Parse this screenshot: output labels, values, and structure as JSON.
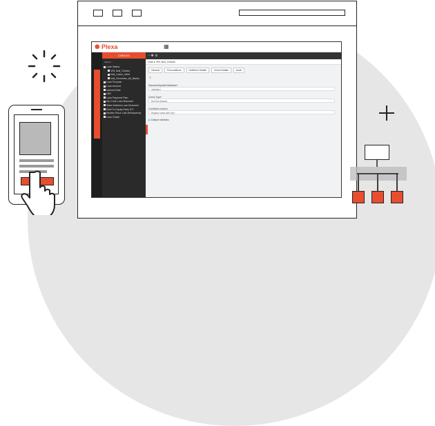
{
  "app": {
    "brand": "Plexa",
    "left_panel_header": "CHECKS",
    "tree_search_label": "Search",
    "tree": [
      {
        "label": "Loan Status",
        "indent": 0
      },
      {
        "label": "VRL Null_Checks",
        "indent": 1
      },
      {
        "label": "Null_Loans_Valid",
        "indent": 1
      },
      {
        "label": "Null_Reminder_All_Banks",
        "indent": 1
      },
      {
        "label": "Loan Purpose",
        "indent": 0
      },
      {
        "label": "Loan Amount",
        "indent": 0
      },
      {
        "label": "Interest Rate",
        "indent": 0
      },
      {
        "label": "LBS",
        "indent": 0
      },
      {
        "label": "Loan Payment Plan",
        "indent": 0
      },
      {
        "label": "Zip Code Loan Borrower",
        "indent": 0
      },
      {
        "label": "State Address Loan Borrower",
        "indent": 0
      },
      {
        "label": "Debt To Equity Ratio DTI",
        "indent": 0
      },
      {
        "label": "Months Since Last Delinquency",
        "indent": 0
      },
      {
        "label": "Loan Grade",
        "indent": 0
      }
    ],
    "breadcrumb": [
      "Loan",
      "VRL Null_Checks"
    ],
    "subtabs": [
      "General",
      "Preconditions",
      "Definition Details",
      "Check Details",
      "Audit"
    ],
    "fields": [
      {
        "label": "Standard/Update/Validation*",
        "value": "Validation"
      },
      {
        "label": "Check Type*",
        "value": "Null Not Allowed"
      },
      {
        "label": "Conditions section",
        "value": "Replace value with Zero"
      }
    ],
    "collapse_label": "Collapse statistics"
  }
}
